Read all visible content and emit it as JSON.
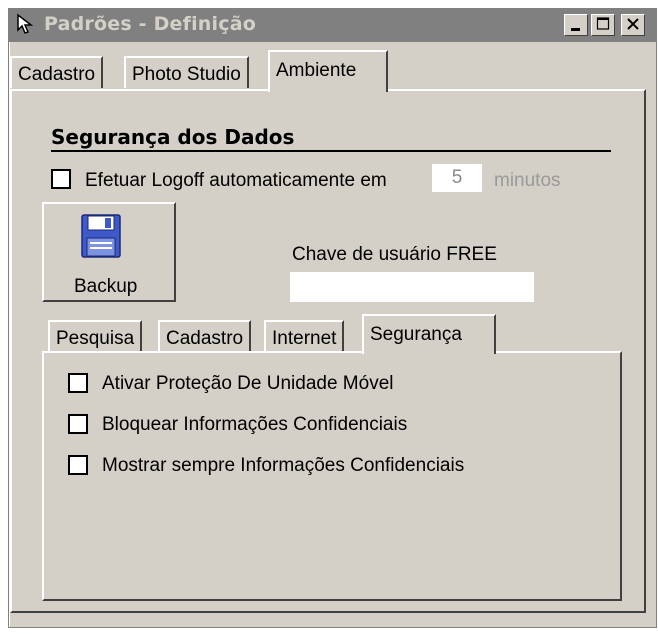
{
  "window": {
    "title": "Padrões - Definição",
    "icon": "mouse-pointer-icon",
    "controls": [
      "minimize",
      "maximize",
      "close"
    ]
  },
  "main_tabs": [
    {
      "label": "Cadastro",
      "active": false
    },
    {
      "label": "Photo Studio",
      "active": false
    },
    {
      "label": "Ambiente",
      "active": true
    }
  ],
  "security_section": {
    "title": "Segurança dos Dados",
    "logoff_label": "Efetuar Logoff automaticamente em",
    "logoff_checked": false,
    "logoff_minutes": "5",
    "minutes_unit": "minutos"
  },
  "backup_button": {
    "label": "Backup",
    "icon": "floppy-disk-icon"
  },
  "free_key": {
    "label": "Chave de usuário FREE",
    "value": ""
  },
  "sub_tabs": [
    {
      "label": "Pesquisa",
      "active": false
    },
    {
      "label": "Cadastro",
      "active": false
    },
    {
      "label": "Internet",
      "active": false
    },
    {
      "label": "Segurança",
      "active": true
    }
  ],
  "security_options": [
    {
      "label": "Ativar Proteção De Unidade Móvel",
      "checked": false
    },
    {
      "label": "Bloquear Informações Confidenciais",
      "checked": false
    },
    {
      "label": "Mostrar sempre Informações Confidenciais",
      "checked": false
    }
  ]
}
